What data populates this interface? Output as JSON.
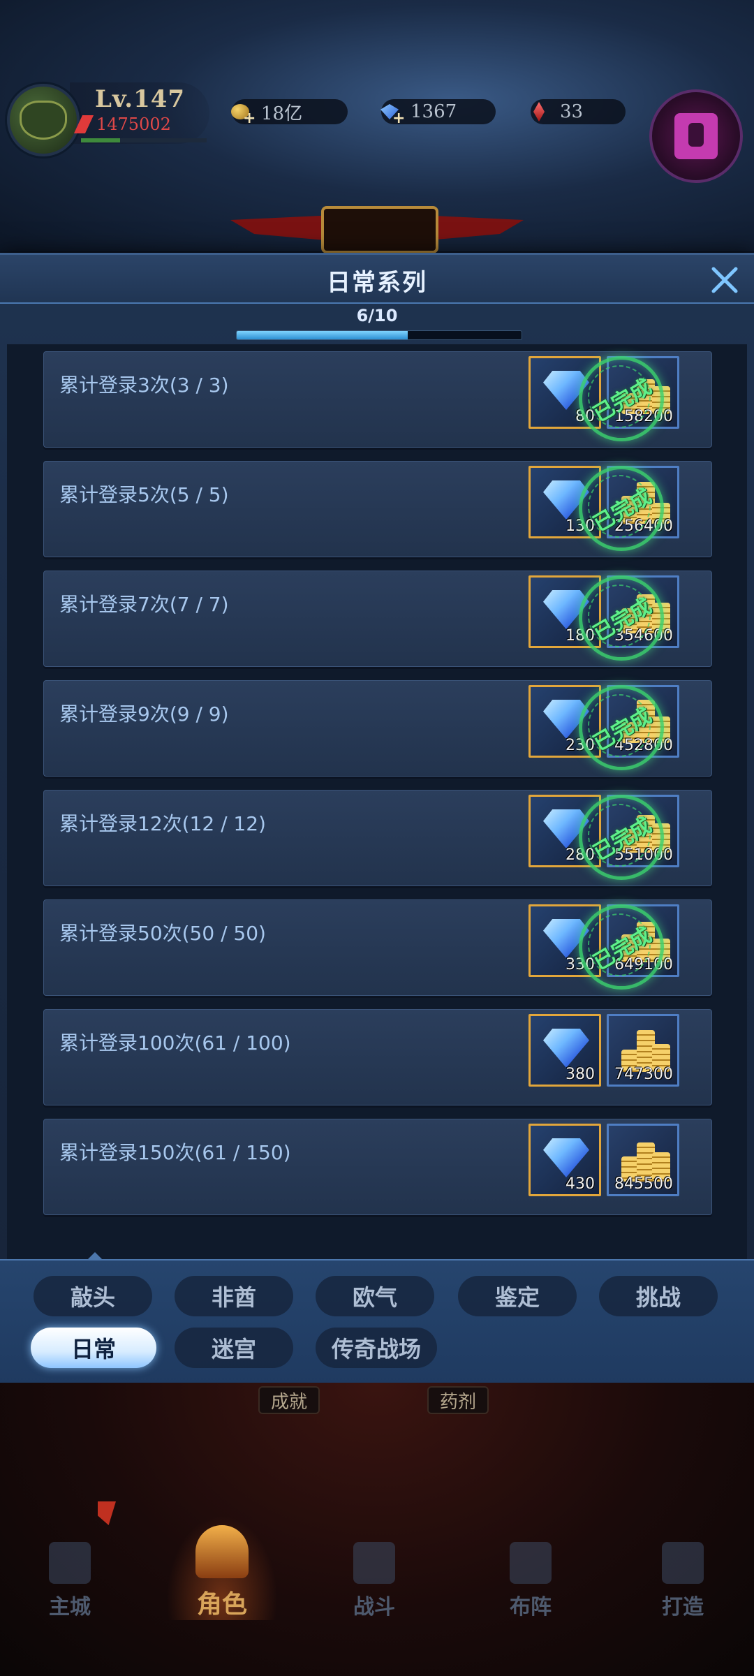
{
  "player": {
    "level": "Lv.147",
    "power": "1475002"
  },
  "resources": {
    "gold": "18亿",
    "gems": "1367",
    "ruby": "33"
  },
  "modal": {
    "title": "日常系列",
    "progress_text": "6/10",
    "progress_fraction": 0.6,
    "completed_stamp": "已完成"
  },
  "tasks": [
    {
      "label": "累计登录3次(3 / 3)",
      "gem_amount": "80",
      "gold_amount": "158200",
      "completed": true
    },
    {
      "label": "累计登录5次(5 / 5)",
      "gem_amount": "130",
      "gold_amount": "256400",
      "completed": true
    },
    {
      "label": "累计登录7次(7 / 7)",
      "gem_amount": "180",
      "gold_amount": "354600",
      "completed": true
    },
    {
      "label": "累计登录9次(9 / 9)",
      "gem_amount": "230",
      "gold_amount": "452800",
      "completed": true
    },
    {
      "label": "累计登录12次(12 / 12)",
      "gem_amount": "280",
      "gold_amount": "551000",
      "completed": true
    },
    {
      "label": "累计登录50次(50 / 50)",
      "gem_amount": "330",
      "gold_amount": "649100",
      "completed": true
    },
    {
      "label": "累计登录100次(61 / 100)",
      "gem_amount": "380",
      "gold_amount": "747300",
      "completed": false
    },
    {
      "label": "累计登录150次(61 / 150)",
      "gem_amount": "430",
      "gold_amount": "845500",
      "completed": false
    }
  ],
  "tabs": {
    "row1": [
      "敲头",
      "非酋",
      "欧气",
      "鉴定",
      "挑战"
    ],
    "row2": [
      "日常",
      "迷宫",
      "传奇战场"
    ],
    "active": "日常"
  },
  "background_labels": {
    "achievement": "成就",
    "potion": "药剂"
  },
  "nav": [
    "主城",
    "角色",
    "战斗",
    "布阵",
    "打造"
  ],
  "nav_active": "角色",
  "colors": {
    "accent_blue": "#4b79b1",
    "stamp_green": "#5ef08a",
    "gem_border": "#e2a63b",
    "gold_border": "#4f7ec4"
  }
}
